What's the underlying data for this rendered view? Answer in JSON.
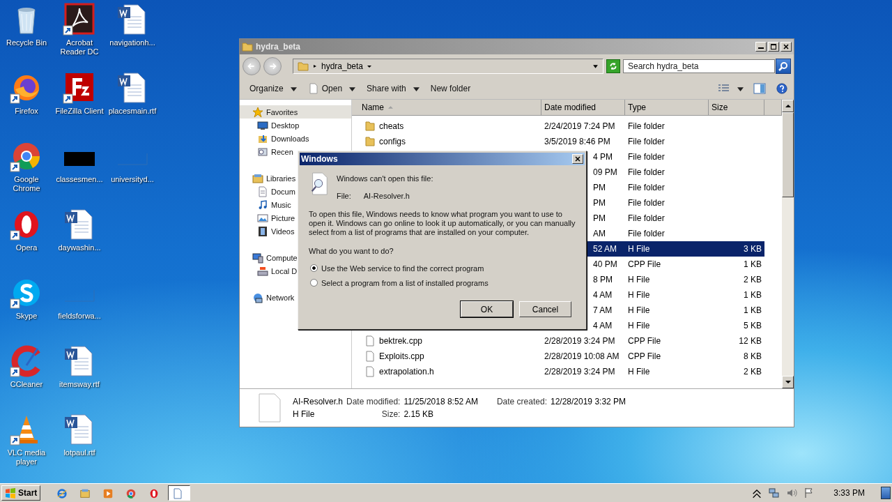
{
  "desktop_icons": [
    {
      "label": "Recycle Bin",
      "kind": "recycle",
      "shortcut": false
    },
    {
      "label": "Firefox",
      "kind": "firefox",
      "shortcut": true
    },
    {
      "label": "Google Chrome",
      "kind": "chrome",
      "shortcut": true
    },
    {
      "label": "Opera",
      "kind": "opera",
      "shortcut": true
    },
    {
      "label": "Skype",
      "kind": "skype",
      "shortcut": true
    },
    {
      "label": "CCleaner",
      "kind": "ccleaner",
      "shortcut": true
    },
    {
      "label": "VLC media player",
      "kind": "vlc",
      "shortcut": true
    },
    {
      "label": "Acrobat Reader DC",
      "kind": "acrobat",
      "shortcut": true
    },
    {
      "label": "FileZilla Client",
      "kind": "filezilla",
      "shortcut": true
    },
    {
      "label": "classesmen...",
      "kind": "dark",
      "shortcut": false
    },
    {
      "label": "daywashin...",
      "kind": "word",
      "shortcut": false
    },
    {
      "label": "fieldsforwa...",
      "kind": "blank",
      "shortcut": false
    },
    {
      "label": "itemsway.rtf",
      "kind": "word",
      "shortcut": false
    },
    {
      "label": "lotpaul.rtf",
      "kind": "word",
      "shortcut": false
    },
    {
      "label": "navigationh...",
      "kind": "word",
      "shortcut": false
    },
    {
      "label": "placesmain.rtf",
      "kind": "word",
      "shortcut": false
    },
    {
      "label": "universityd...",
      "kind": "blank",
      "shortcut": false
    }
  ],
  "explorer": {
    "title": "hydra_beta",
    "address": "hydra_beta",
    "search": {
      "placeholder": "Search hydra_beta"
    },
    "toolbar": [
      {
        "label": "Organize",
        "kind": "menu"
      },
      {
        "label": "Open",
        "kind": "open"
      },
      {
        "label": "Share with",
        "kind": "menu"
      },
      {
        "label": "New folder",
        "kind": "plain"
      }
    ],
    "nav": [
      {
        "label": "Favorites",
        "kind": "star",
        "selected": true,
        "children": [
          {
            "label": "Desktop",
            "kind": "desktop",
            "selected": false
          },
          {
            "label": "Downloads",
            "kind": "downloads",
            "selected": false
          },
          {
            "label": "Recen",
            "kind": "recent",
            "selected": false
          }
        ]
      },
      {
        "label": "Libraries",
        "kind": "library",
        "selected": false,
        "children": [
          {
            "label": "Docum",
            "kind": "documents",
            "selected": false
          },
          {
            "label": "Music",
            "kind": "music",
            "selected": false
          },
          {
            "label": "Picture",
            "kind": "pictures",
            "selected": false
          },
          {
            "label": "Videos",
            "kind": "videos",
            "selected": false
          }
        ]
      },
      {
        "label": "Compute",
        "kind": "computer",
        "selected": false,
        "children": [
          {
            "label": "Local D",
            "kind": "drive",
            "selected": false
          }
        ]
      },
      {
        "label": "Network",
        "kind": "network",
        "selected": false
      }
    ],
    "columns": [
      "Name",
      "Date modified",
      "Type",
      "Size"
    ],
    "rows": [
      {
        "kind": "folder",
        "name": "cheats",
        "date": "2/24/2019 7:24 PM",
        "type": "File folder",
        "size": "",
        "selected": false
      },
      {
        "kind": "folder",
        "name": "configs",
        "date": "3/5/2019 8:46 PM",
        "type": "File folder",
        "size": "",
        "selected": false
      },
      {
        "kind": "covered",
        "date": "4 PM",
        "type": "File folder",
        "size": "",
        "selected": false
      },
      {
        "kind": "covered",
        "date": "09 PM",
        "type": "File folder",
        "size": "",
        "selected": false
      },
      {
        "kind": "covered",
        "date": "PM",
        "type": "File folder",
        "size": "",
        "selected": false
      },
      {
        "kind": "covered",
        "date": "PM",
        "type": "File folder",
        "size": "",
        "selected": false
      },
      {
        "kind": "covered",
        "date": "PM",
        "type": "File folder",
        "size": "",
        "selected": false
      },
      {
        "kind": "covered",
        "date": "AM",
        "type": "File folder",
        "size": "",
        "selected": false
      },
      {
        "kind": "covered",
        "date": "52 AM",
        "type": "H File",
        "size": "3 KB",
        "selected": true
      },
      {
        "kind": "covered",
        "date": "40 PM",
        "type": "CPP File",
        "size": "1 KB",
        "selected": false
      },
      {
        "kind": "covered",
        "date": "8 PM",
        "type": "H File",
        "size": "2 KB",
        "selected": false
      },
      {
        "kind": "covered",
        "date": "4 AM",
        "type": "H File",
        "size": "1 KB",
        "selected": false
      },
      {
        "kind": "covered",
        "date": "7 AM",
        "type": "H File",
        "size": "1 KB",
        "selected": false
      },
      {
        "kind": "covered",
        "date": "4 AM",
        "type": "H File",
        "size": "5 KB",
        "selected": false
      },
      {
        "kind": "file",
        "name": "bektrek.cpp",
        "date": "2/28/2019 3:24 PM",
        "type": "CPP File",
        "size": "12 KB",
        "selected": false
      },
      {
        "kind": "file",
        "name": "Exploits.cpp",
        "date": "2/28/2019 10:08 AM",
        "type": "CPP File",
        "size": "8 KB",
        "selected": false
      },
      {
        "kind": "file",
        "name": "extrapolation.h",
        "date": "2/28/2019 3:24 PM",
        "type": "H File",
        "size": "2 KB",
        "selected": false
      }
    ],
    "details": {
      "name": "AI-Resolver.h",
      "type": "H File",
      "modified_label": "Date modified:",
      "modified": "11/25/2018 8:52 AM",
      "created_label": "Date created:",
      "created": "12/28/2019 3:32 PM",
      "size_label": "Size:",
      "size": "2.15 KB"
    }
  },
  "dialog": {
    "title": "Windows",
    "heading": "Windows can't open this file:",
    "file_label": "File:",
    "file_name": "AI-Resolver.h",
    "message": "To open this file, Windows needs to know what program you want to use to open it. Windows can go online to look it up automatically, or you can manually select from a list of programs that are installed on your computer.",
    "question": "What do you want to do?",
    "options": [
      {
        "label": "Use the Web service to find the correct program",
        "selected": true
      },
      {
        "label": "Select a program from a list of installed programs",
        "selected": false
      }
    ],
    "buttons": [
      {
        "label": "OK",
        "default": true
      },
      {
        "label": "Cancel",
        "default": false
      }
    ]
  },
  "taskbar": {
    "start": "Start",
    "items": [
      {
        "kind": "ie",
        "selected": false
      },
      {
        "kind": "explorer",
        "selected": false
      },
      {
        "kind": "media",
        "selected": false
      },
      {
        "kind": "chrome",
        "selected": false
      },
      {
        "kind": "opera",
        "selected": false
      },
      {
        "kind": "window",
        "selected": true
      }
    ],
    "clock": "3:33 PM"
  }
}
